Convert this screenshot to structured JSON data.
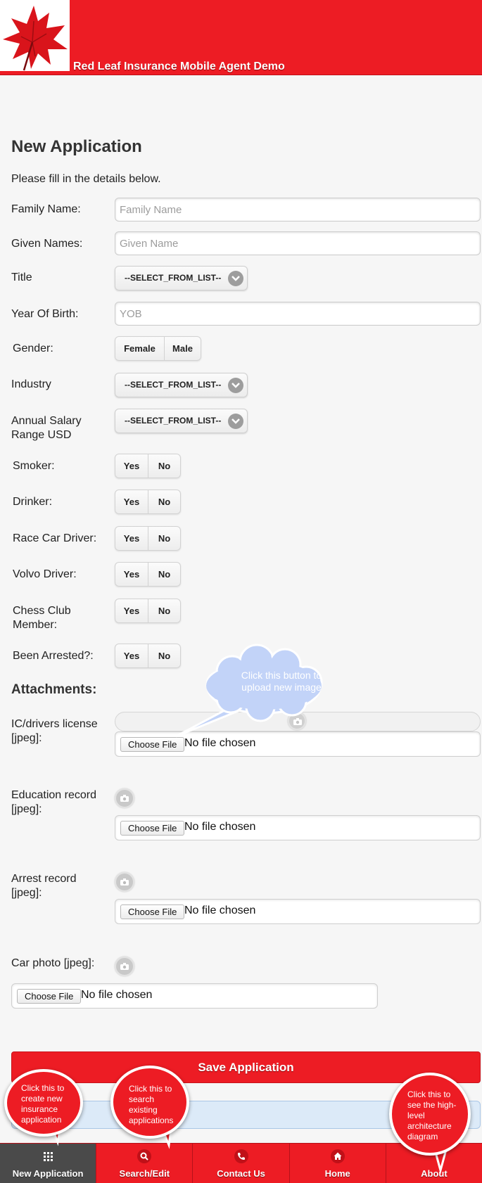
{
  "header": {
    "title": "Red Leaf Insurance Mobile Agent Demo",
    "logo": "red-leaf-logo"
  },
  "page": {
    "heading": "New Application",
    "intro": "Please fill in the details below."
  },
  "form": {
    "family_name": {
      "label": "Family Name:",
      "placeholder": "Family Name"
    },
    "given_names": {
      "label": "Given Names:",
      "placeholder": "Given Name"
    },
    "title": {
      "label": "Title",
      "value": "--SELECT_FROM_LIST--"
    },
    "year_of_birth": {
      "label": "Year Of Birth:",
      "placeholder": "YOB"
    },
    "gender": {
      "label": "Gender:",
      "options": [
        "Female",
        "Male"
      ]
    },
    "industry": {
      "label": "Industry",
      "value": "--SELECT_FROM_LIST--"
    },
    "salary": {
      "label": "Annual Salary Range USD",
      "value": "--SELECT_FROM_LIST--"
    },
    "yes_label": "Yes",
    "no_label": "No",
    "smoker": {
      "label": "Smoker:"
    },
    "drinker": {
      "label": "Drinker:"
    },
    "race_car": {
      "label": "Race Car Driver:"
    },
    "volvo": {
      "label": "Volvo Driver:"
    },
    "chess": {
      "label": "Chess Club Member:"
    },
    "arrested": {
      "label": "Been Arrested?:"
    }
  },
  "attachments": {
    "heading": "Attachments:",
    "choose_label": "Choose File",
    "no_file": "No file chosen",
    "items": [
      {
        "label": "IC/drivers license [jpeg]:"
      },
      {
        "label": "Education record [jpeg]:"
      },
      {
        "label": "Arrest record [jpeg]:"
      },
      {
        "label": "Car photo [jpeg]:"
      }
    ]
  },
  "actions": {
    "save_label": "Save Application"
  },
  "tooltips": {
    "upload": "Click this button to upload new image",
    "new_app": "Click this to create new insurance application",
    "search": "Click this to search existing applications",
    "about": "Click this to see the high-level architecture diagram"
  },
  "navbar": {
    "items": [
      {
        "label": "New Application",
        "icon": "grid-icon"
      },
      {
        "label": "Search/Edit",
        "icon": "search-icon"
      },
      {
        "label": "Contact Us",
        "icon": "phone-icon"
      },
      {
        "label": "Home",
        "icon": "home-icon"
      },
      {
        "label": "About",
        "icon": "info-icon"
      }
    ]
  },
  "colors": {
    "brand_red": "#ed1c24",
    "active_nav": "#4a4a4a",
    "cloud": "#c2d3f8"
  }
}
